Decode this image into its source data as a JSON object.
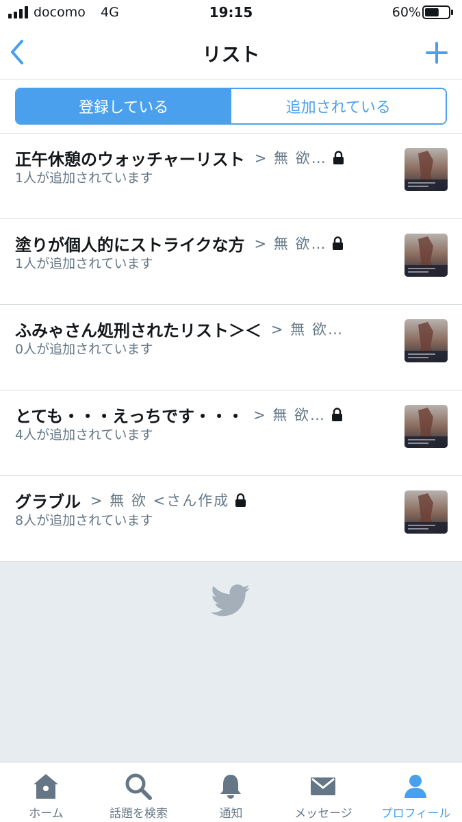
{
  "status_bar": {
    "carrier": "docomo",
    "network": "4G",
    "time": "19:15",
    "battery_percent": "60%",
    "battery_level": 0.6
  },
  "nav": {
    "title": "リスト",
    "back_icon": "chevron-left-icon",
    "add_icon": "plus-icon"
  },
  "segments": {
    "subscribed": "登録している",
    "member_of": "追加されている",
    "active": "subscribed"
  },
  "lists": [
    {
      "name": "正午休憩のウォッチャーリスト",
      "owner": "> 無 欲…",
      "members": "1人が追加されています",
      "private": true
    },
    {
      "name": "塗りが個人的にストライクな方",
      "owner": "> 無 欲…",
      "members": "1人が追加されています",
      "private": true
    },
    {
      "name": "ふみゃさん処刑されたリスト＞＜",
      "owner": "> 無 欲…",
      "members": "0人が追加されています",
      "private": false
    },
    {
      "name": "とても・・・えっちです・・・",
      "owner": "> 無 欲…",
      "members": "4人が追加されています",
      "private": true
    },
    {
      "name": "グラブル",
      "owner": "> 無 欲 <さん作成",
      "members": "8人が追加されています",
      "private": true
    }
  ],
  "tabs": [
    {
      "label": "ホーム",
      "icon": "home-icon",
      "active": false
    },
    {
      "label": "話題を検索",
      "icon": "search-icon",
      "active": false
    },
    {
      "label": "通知",
      "icon": "bell-icon",
      "active": false
    },
    {
      "label": "メッセージ",
      "icon": "envelope-icon",
      "active": false
    },
    {
      "label": "プロフィール",
      "icon": "person-icon",
      "active": true
    }
  ],
  "colors": {
    "accent": "#4aa0ec",
    "text": "#14171a",
    "secondary": "#657786",
    "empty_bg": "#e6ecf0",
    "divider": "#d8dde1"
  }
}
